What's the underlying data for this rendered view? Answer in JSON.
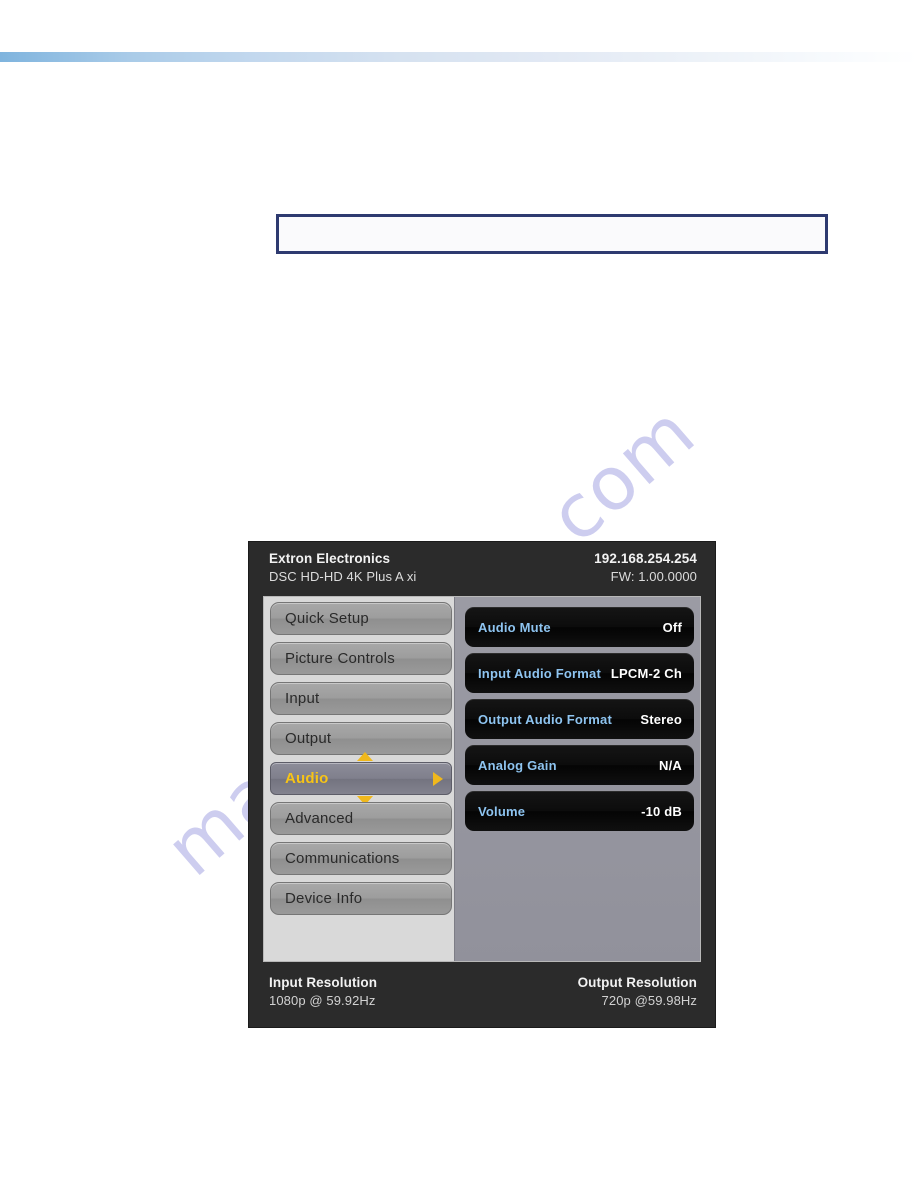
{
  "page": {
    "note_box_text": ""
  },
  "watermark": {
    "text": "manualshive.com",
    "color": "#cdcdef"
  },
  "osd": {
    "header": {
      "brand": "Extron Electronics",
      "model": "DSC HD-HD 4K Plus A xi",
      "ip_address": "192.168.254.254",
      "firmware": "FW: 1.00.0000"
    },
    "menu": {
      "items": [
        {
          "label": "Quick Setup",
          "selected": false
        },
        {
          "label": "Picture Controls",
          "selected": false
        },
        {
          "label": "Input",
          "selected": false
        },
        {
          "label": "Output",
          "selected": false
        },
        {
          "label": "Audio",
          "selected": true
        },
        {
          "label": "Advanced",
          "selected": false
        },
        {
          "label": "Communications",
          "selected": false
        },
        {
          "label": "Device Info",
          "selected": false
        }
      ],
      "selected_label": "Audio",
      "highlight_color": "#f7c416",
      "arrow_color": "#f0b81c"
    },
    "submenu": {
      "items": [
        {
          "label": "Audio Mute",
          "value": "Off"
        },
        {
          "label": "Input Audio Format",
          "value": "LPCM-2 Ch"
        },
        {
          "label": "Output Audio Format",
          "value": "Stereo"
        },
        {
          "label": "Analog Gain",
          "value": "N/A"
        },
        {
          "label": "Volume",
          "value": "-10 dB"
        }
      ],
      "label_color": "#8ec4f0",
      "value_color": "#ffffff"
    },
    "footer": {
      "input_title": "Input Resolution",
      "input_value": "1080p @ 59.92Hz",
      "output_title": "Output Resolution",
      "output_value": "720p @59.98Hz"
    }
  }
}
